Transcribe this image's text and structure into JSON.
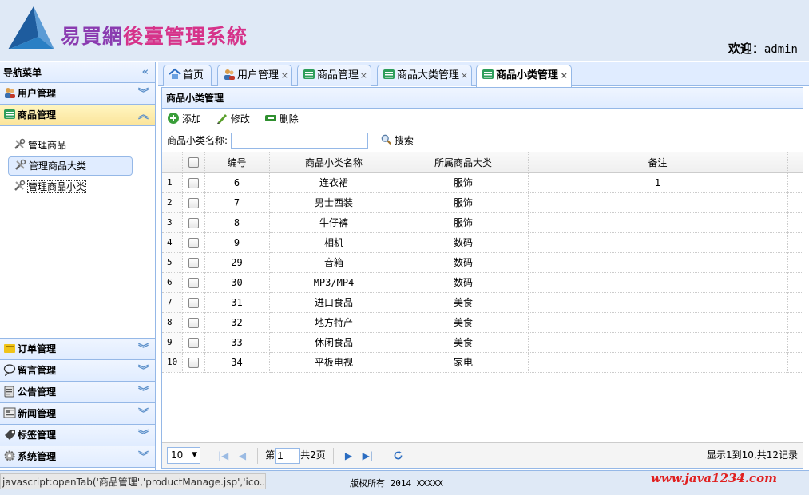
{
  "header": {
    "title_part1": "易買網",
    "title_part2": "後臺管理系統",
    "welcome_label": "欢迎：",
    "username": "admin"
  },
  "sidebar": {
    "title": "导航菜单",
    "sections": [
      {
        "label": "用户管理"
      },
      {
        "label": "商品管理"
      },
      {
        "label": "订单管理"
      },
      {
        "label": "留言管理"
      },
      {
        "label": "公告管理"
      },
      {
        "label": "新闻管理"
      },
      {
        "label": "标签管理"
      },
      {
        "label": "系统管理"
      }
    ],
    "product_items": [
      "管理商品",
      "管理商品大类",
      "管理商品小类"
    ]
  },
  "tabs": [
    "首页",
    "用户管理",
    "商品管理",
    "商品大类管理",
    "商品小类管理"
  ],
  "panel": {
    "title": "商品小类管理"
  },
  "toolbar": {
    "add": "添加",
    "edit": "修改",
    "delete": "删除"
  },
  "search": {
    "label": "商品小类名称:",
    "value": "",
    "button": "搜索"
  },
  "grid": {
    "headers": [
      "编号",
      "商品小类名称",
      "所属商品大类",
      "备注"
    ],
    "rows": [
      {
        "n": "1",
        "id": "6",
        "name": "连衣裙",
        "cat": "服饰",
        "note": "1"
      },
      {
        "n": "2",
        "id": "7",
        "name": "男士西装",
        "cat": "服饰",
        "note": ""
      },
      {
        "n": "3",
        "id": "8",
        "name": "牛仔裤",
        "cat": "服饰",
        "note": ""
      },
      {
        "n": "4",
        "id": "9",
        "name": "相机",
        "cat": "数码",
        "note": ""
      },
      {
        "n": "5",
        "id": "29",
        "name": "音箱",
        "cat": "数码",
        "note": ""
      },
      {
        "n": "6",
        "id": "30",
        "name": "MP3/MP4",
        "cat": "数码",
        "note": ""
      },
      {
        "n": "7",
        "id": "31",
        "name": "进口食品",
        "cat": "美食",
        "note": ""
      },
      {
        "n": "8",
        "id": "32",
        "name": "地方特产",
        "cat": "美食",
        "note": ""
      },
      {
        "n": "9",
        "id": "33",
        "name": "休闲食品",
        "cat": "美食",
        "note": ""
      },
      {
        "n": "10",
        "id": "34",
        "name": "平板电视",
        "cat": "家电",
        "note": ""
      }
    ]
  },
  "pager": {
    "page_size": "10",
    "page_prefix": "第",
    "current_page": "1",
    "total_pages": "共2页",
    "info": "显示1到10,共12记录"
  },
  "footer": {
    "status": "javascript:openTab('商品管理','productManage.jsp','ico...",
    "copyright": "版权所有 2014 XXXXX",
    "watermark": "www.java1234.com"
  },
  "colors": {
    "accent": "#95b8e7",
    "active_section": "#fbe49a",
    "watermark": "#e02020"
  }
}
